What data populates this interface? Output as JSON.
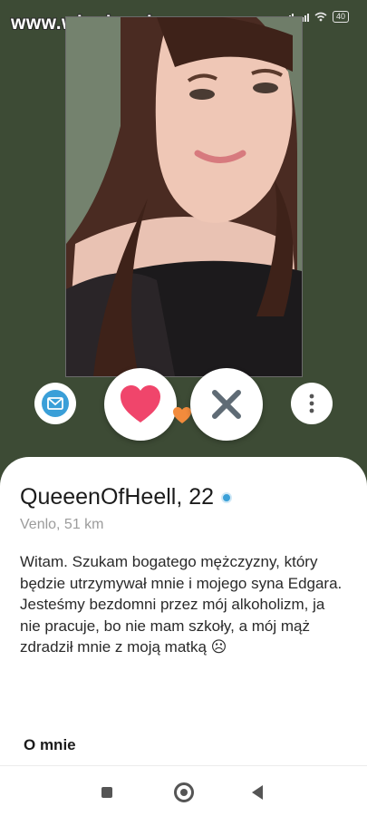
{
  "status_bar": {
    "watermark": "www.wiocha.pl",
    "battery": "40"
  },
  "profile": {
    "name_age": "QueeenOfHeell, 22",
    "location_distance": "Venlo, 51 km",
    "bio": "Witam. Szukam bogatego mężczyzny, który będzie utrzymywał mnie i mojego syna Edgara. Jesteśmy bezdomni przez mój alkoholizm, ja nie pracuje, bo nie mam szkoły, a mój mąż zdradził mnie z moją matką ☹",
    "about_heading": "O mnie"
  },
  "actions": {
    "message_icon": "envelope-icon",
    "like_icon": "heart-icon",
    "nope_icon": "x-icon",
    "more_icon": "more-vertical-icon"
  },
  "colors": {
    "background": "#3d4b35",
    "like": "#f0456b",
    "nope": "#5f6b75",
    "message": "#3a9fd8",
    "verified": "#3aa0d8"
  },
  "navbar": {
    "recents_icon": "square-icon",
    "home_icon": "circle-icon",
    "back_icon": "triangle-back-icon"
  }
}
